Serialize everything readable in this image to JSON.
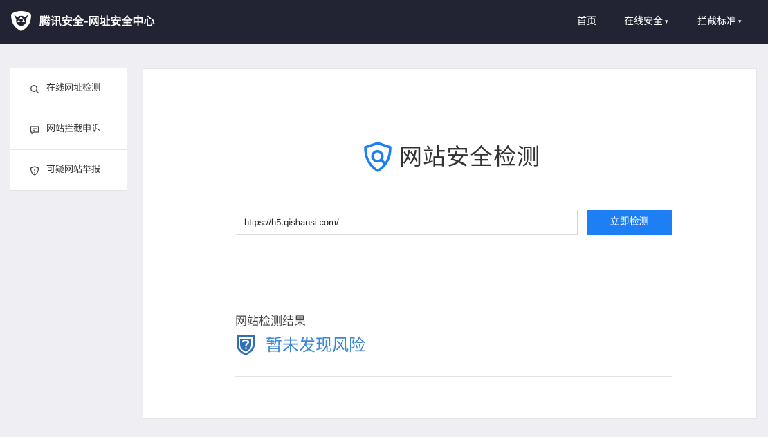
{
  "header": {
    "brand": "腾讯安全-网址安全中心",
    "nav": [
      {
        "label": "首页",
        "has_dropdown": false
      },
      {
        "label": "在线安全",
        "has_dropdown": true
      },
      {
        "label": "拦截标准",
        "has_dropdown": true
      }
    ],
    "caret": "▾",
    "logo_icon": "tencent-security-logo-icon",
    "background_color": "#222433"
  },
  "sidebar": {
    "items": [
      {
        "label": "在线网址检测",
        "icon": "search-icon"
      },
      {
        "label": "网站拦截申诉",
        "icon": "chat-bubble-icon"
      },
      {
        "label": "可疑网站举报",
        "icon": "shield-alert-icon"
      }
    ]
  },
  "main": {
    "title": "网站安全检测",
    "title_icon": "shield-search-icon",
    "search": {
      "value": "https://h5.qishansi.com/",
      "button_label": "立即检测"
    },
    "result": {
      "heading": "网站检测结果",
      "status": "暂未发现风险",
      "status_icon": "shield-unknown-icon"
    }
  },
  "colors": {
    "accent": "#1d7ff3",
    "result_text": "#3a86d8",
    "page_background": "#efeff3"
  }
}
